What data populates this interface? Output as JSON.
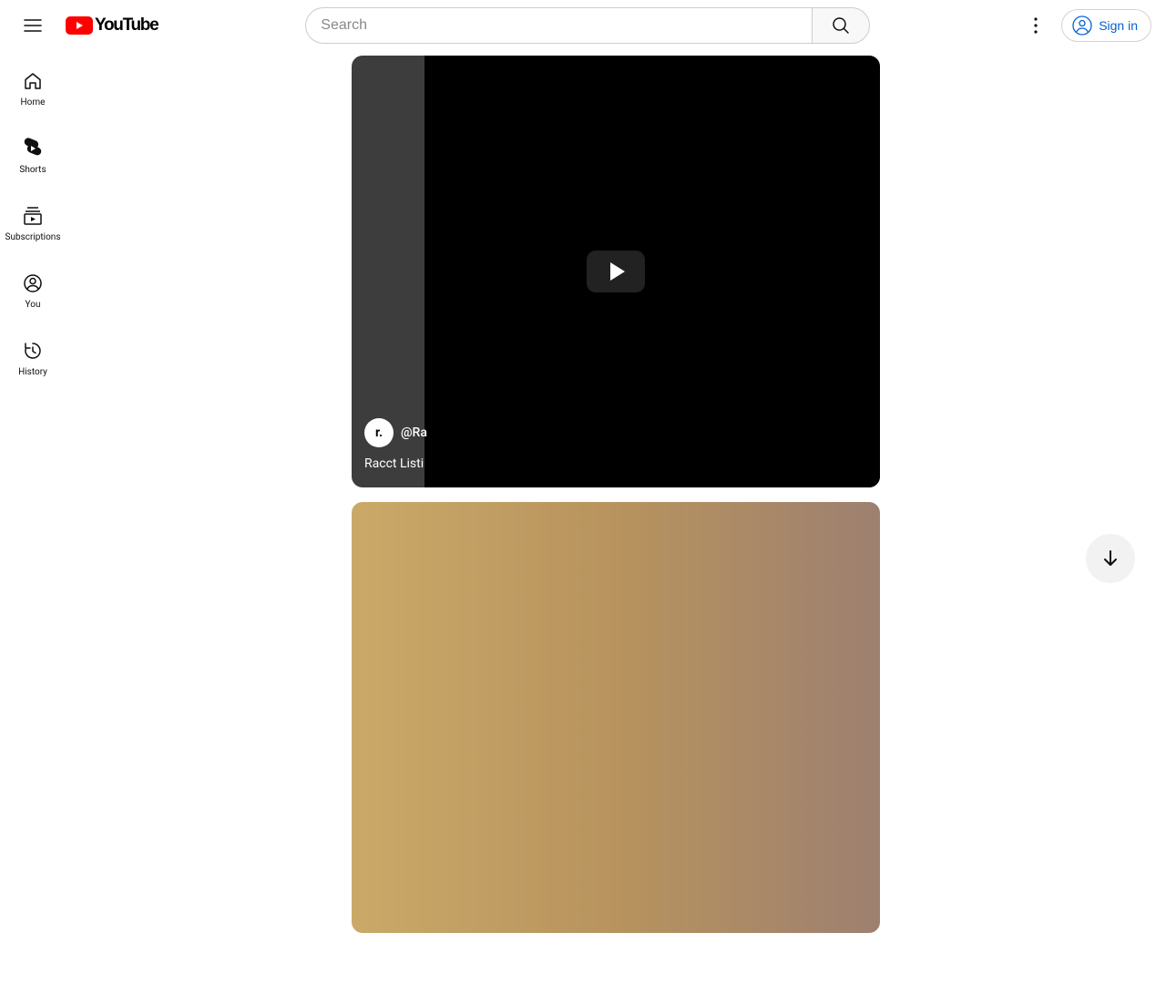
{
  "brand": {
    "name": "YouTube"
  },
  "search": {
    "placeholder": "Search"
  },
  "header": {
    "signin_label": "Sign in"
  },
  "sidebar": {
    "items": [
      {
        "label": "Home"
      },
      {
        "label": "Shorts"
      },
      {
        "label": "Subscriptions"
      },
      {
        "label": "You"
      },
      {
        "label": "History"
      }
    ]
  },
  "short": {
    "channel_handle": "@Ra",
    "title": "Racct Listi",
    "avatar_letter": "r."
  }
}
